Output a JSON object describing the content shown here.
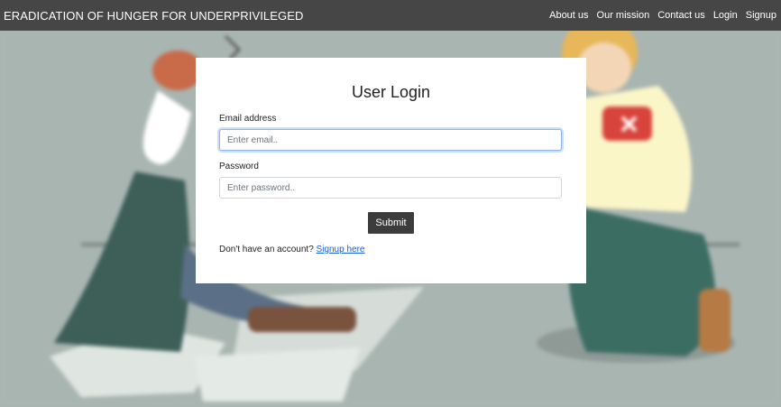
{
  "navbar": {
    "brand": "ERADICATION OF HUNGER FOR UNDERPRIVILEGED",
    "links": [
      "About us",
      "Our mission",
      "Contact us",
      "Login",
      "Signup"
    ]
  },
  "login": {
    "title": "User Login",
    "email_label": "Email address",
    "email_placeholder": "Enter email..",
    "password_label": "Password",
    "password_placeholder": "Enter password..",
    "submit_label": "Submit",
    "signup_prompt": "Don't have an account?",
    "signup_link": "Signup here"
  },
  "colors": {
    "navbar_bg": "#464646",
    "background": "#a9b5b1",
    "submit_bg": "#3c3c3c",
    "link": "#1a5fd6"
  }
}
